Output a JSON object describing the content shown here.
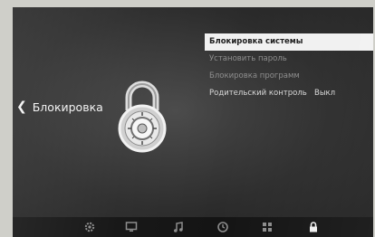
{
  "back_nav": {
    "chevron": "❮",
    "label": "Блокировка"
  },
  "menu": {
    "items": [
      {
        "label": "Блокировка системы",
        "value": ""
      },
      {
        "label": "Установить пароль",
        "value": ""
      },
      {
        "label": "Блокировка программ",
        "value": ""
      },
      {
        "label": "Родительский контроль",
        "value": "Выкл"
      }
    ]
  },
  "bottom_bar": {
    "icons": [
      "gear-icon",
      "monitor-icon",
      "music-icon",
      "clock-icon",
      "apps-icon",
      "lock-icon"
    ],
    "active": "lock-icon"
  },
  "colors": {
    "screen_bg": "#2c2c2c",
    "selected_bg": "#f1f1f1",
    "bar_bg": "#141414"
  }
}
